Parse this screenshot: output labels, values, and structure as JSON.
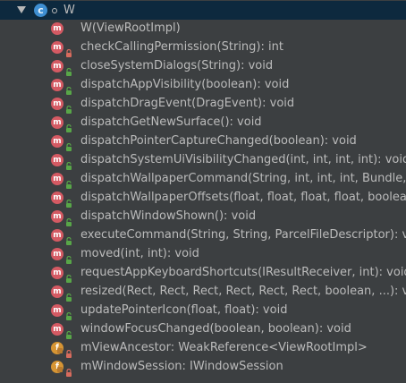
{
  "header": {
    "class_icon_letter": "c",
    "label": "W"
  },
  "items": [
    {
      "label": "W(ViewRootImpl)",
      "icon": "m",
      "access": "none"
    },
    {
      "label": "checkCallingPermission(String): int",
      "icon": "m",
      "access": "private"
    },
    {
      "label": "closeSystemDialogs(String): void",
      "icon": "m",
      "access": "public"
    },
    {
      "label": "dispatchAppVisibility(boolean): void",
      "icon": "m",
      "access": "public"
    },
    {
      "label": "dispatchDragEvent(DragEvent): void",
      "icon": "m",
      "access": "public"
    },
    {
      "label": "dispatchGetNewSurface(): void",
      "icon": "m",
      "access": "public"
    },
    {
      "label": "dispatchPointerCaptureChanged(boolean): void",
      "icon": "m",
      "access": "public"
    },
    {
      "label": "dispatchSystemUiVisibilityChanged(int, int, int, int): void",
      "icon": "m",
      "access": "public"
    },
    {
      "label": "dispatchWallpaperCommand(String, int, int, int, Bundle, boolea",
      "icon": "m",
      "access": "public"
    },
    {
      "label": "dispatchWallpaperOffsets(float, float, float, float, boolean): voi",
      "icon": "m",
      "access": "public"
    },
    {
      "label": "dispatchWindowShown(): void",
      "icon": "m",
      "access": "public"
    },
    {
      "label": "executeCommand(String, String, ParcelFileDescriptor): void",
      "icon": "m",
      "access": "public"
    },
    {
      "label": "moved(int, int): void",
      "icon": "m",
      "access": "public"
    },
    {
      "label": "requestAppKeyboardShortcuts(IResultReceiver, int): void",
      "icon": "m",
      "access": "public"
    },
    {
      "label": "resized(Rect, Rect, Rect, Rect, Rect, Rect, boolean, ...): void",
      "icon": "m",
      "access": "public"
    },
    {
      "label": "updatePointerIcon(float, float): void",
      "icon": "m",
      "access": "public"
    },
    {
      "label": "windowFocusChanged(boolean, boolean): void",
      "icon": "m",
      "access": "public"
    },
    {
      "label": "mViewAncestor: WeakReference<ViewRootImpl>",
      "icon": "f",
      "access": "private"
    },
    {
      "label": "mWindowSession: IWindowSession",
      "icon": "f",
      "access": "private"
    }
  ],
  "colors": {
    "background": "#3c3f41",
    "header_background": "#0d293e",
    "method_icon": "#d45a63",
    "field_icon": "#d69534",
    "public_modifier": "#58a648",
    "private_modifier": "#d76b5d",
    "text": "#bbbbbb"
  }
}
